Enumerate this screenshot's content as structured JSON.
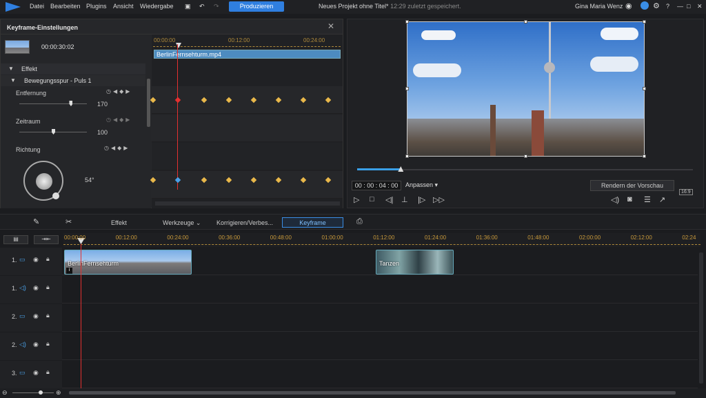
{
  "menu": {
    "items": [
      "Datei",
      "Bearbeiten",
      "Plugins",
      "Ansicht",
      "Wiedergabe"
    ],
    "produce": "Produzieren",
    "project_title": "Neues Projekt ohne Titel*",
    "saved": "12:29 zuletzt gespeichert.",
    "user": "Gina Maria Wenz"
  },
  "keyframe": {
    "title": "Keyframe-Einstellungen",
    "timecode": "00:00:30:02",
    "section_effect": "Effekt",
    "section_track": "Bewegungsspur - Puls 1",
    "params": [
      {
        "label": "Entfernung",
        "value": "170",
        "level": 0.76
      },
      {
        "label": "Zeitraum",
        "value": "100",
        "level": 0.5
      },
      {
        "label": "Richtung",
        "value": "54°"
      }
    ],
    "ruler": [
      "00:00:00",
      "00:12:00",
      "00:24:00"
    ],
    "clip_name": "BerlinFernsehturm.mp4"
  },
  "preview": {
    "timecode": "00 : 00 : 04 : 00",
    "fit": "Anpassen",
    "render": "Rendern der Vorschau",
    "aspect": "16:9",
    "progress": 0.13
  },
  "toolbar": {
    "effect": "Effekt",
    "tools": "Werkzeuge",
    "correct": "Korrigieren/Verbes...",
    "keyframe": "Keyframe"
  },
  "timeline": {
    "ticks": [
      "00:00:00",
      "00:12:00",
      "00:24:00",
      "00:36:00",
      "00:48:00",
      "01:00:00",
      "01:12:00",
      "01:24:00",
      "01:36:00",
      "01:48:00",
      "02:00:00",
      "02:12:00",
      "02:24"
    ],
    "tracks": [
      "1.",
      "1.",
      "2.",
      "2.",
      "3."
    ],
    "clip1": "BerlinFernsehturm",
    "clip2": "Tanzen"
  }
}
